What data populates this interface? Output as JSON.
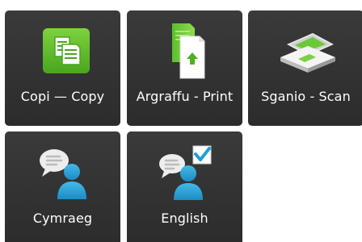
{
  "tiles": [
    {
      "label": "Copi — Copy",
      "icon": "copy-icon"
    },
    {
      "label": "Argraffu - Print",
      "icon": "print-icon"
    },
    {
      "label": "Sganio - Scan",
      "icon": "scan-icon"
    },
    {
      "label": "Cymraeg",
      "icon": "speech-person-icon"
    },
    {
      "label": "English",
      "icon": "speech-person-checked-icon"
    }
  ],
  "colors": {
    "tile": "#333333",
    "accent_green": "#5fbf2a",
    "accent_blue": "#2aa1d6",
    "text": "#ffffff"
  }
}
